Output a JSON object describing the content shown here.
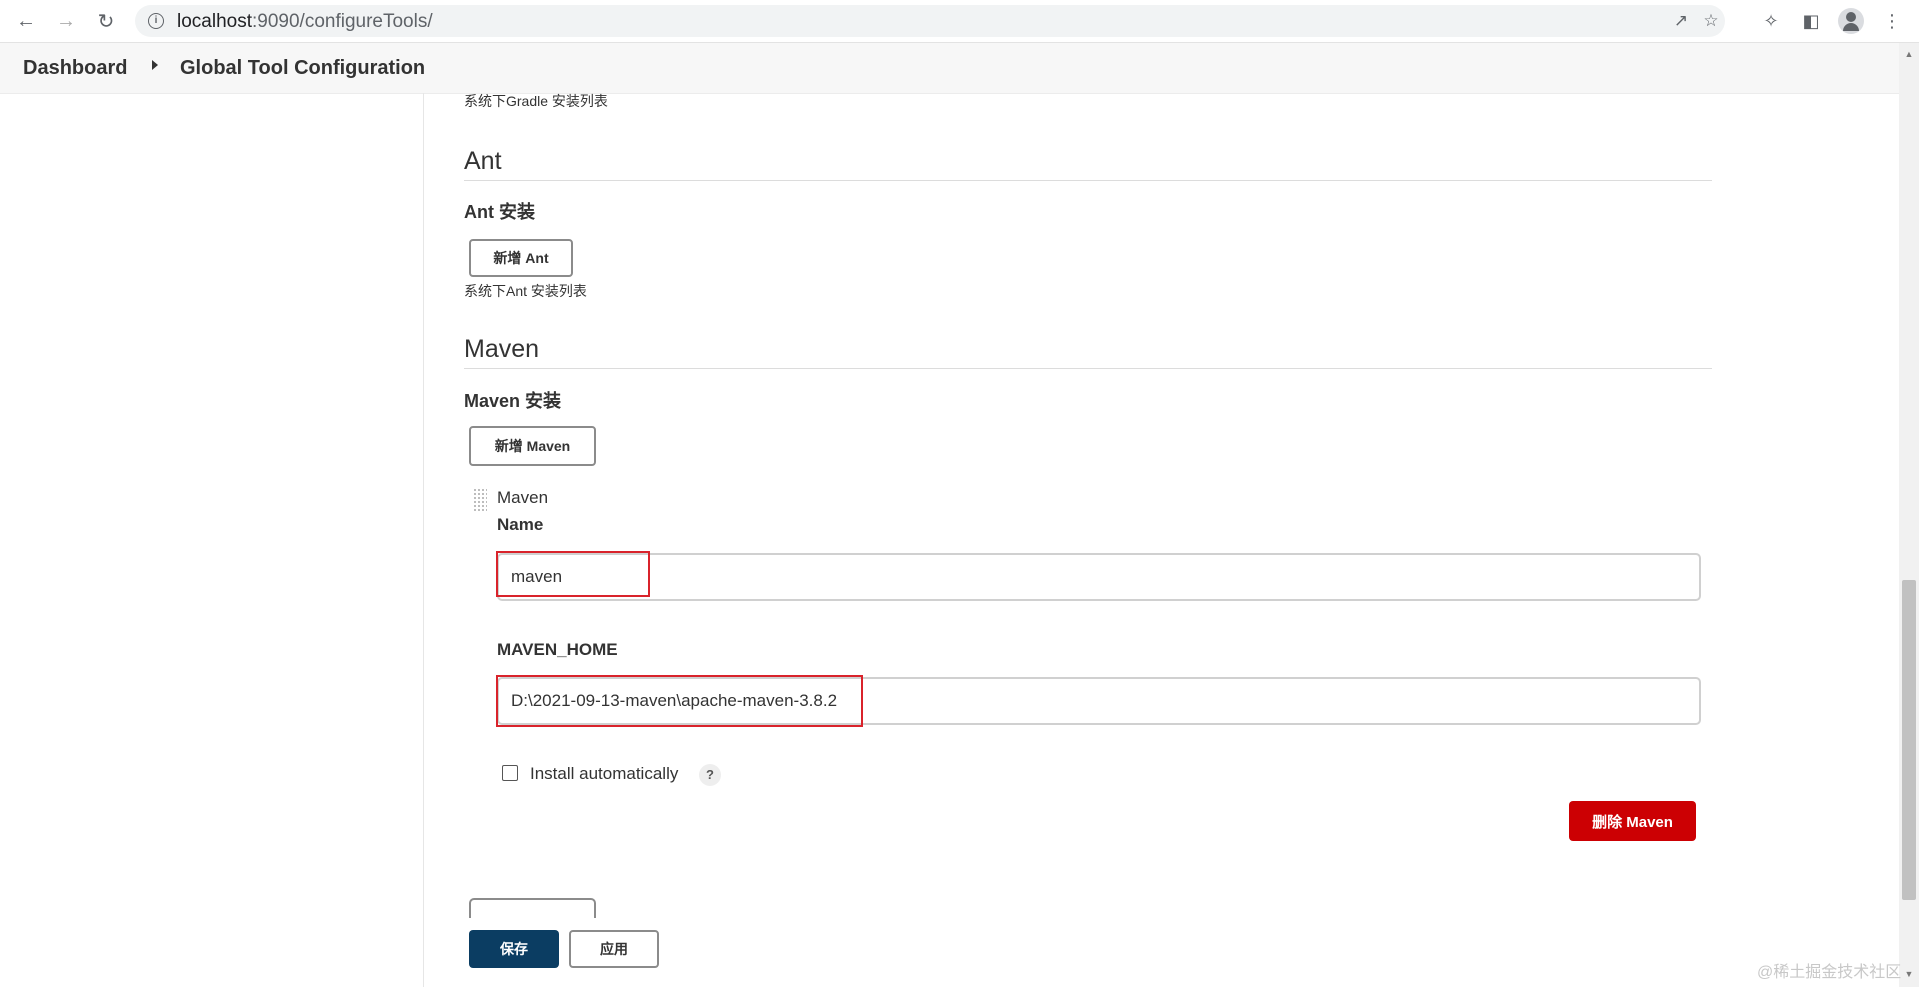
{
  "browser": {
    "url_host": "localhost",
    "url_rest": ":9090/configureTools/"
  },
  "breadcrumb": {
    "items": [
      "Dashboard",
      "Global Tool Configuration"
    ]
  },
  "gradle": {
    "description": "系统下Gradle 安装列表"
  },
  "ant": {
    "title": "Ant",
    "installations_label": "Ant 安装",
    "add_button": "新增 Ant",
    "description": "系统下Ant 安装列表"
  },
  "maven": {
    "title": "Maven",
    "installations_label": "Maven 安装",
    "add_button": "新增 Maven",
    "entry": {
      "header": "Maven",
      "name_label": "Name",
      "name_value": "maven",
      "home_label": "MAVEN_HOME",
      "home_value": "D:\\2021-09-13-maven\\apache-maven-3.8.2",
      "install_auto_label": "Install automatically",
      "install_auto_checked": false,
      "help_glyph": "?",
      "delete_button": "删除 Maven"
    }
  },
  "footer": {
    "save_button": "保存",
    "apply_button": "应用"
  },
  "watermark": "@稀土掘金技术社区",
  "colors": {
    "save_bg": "#0b3d62",
    "delete_bg": "#cc0003",
    "highlight": "#d9232b"
  }
}
